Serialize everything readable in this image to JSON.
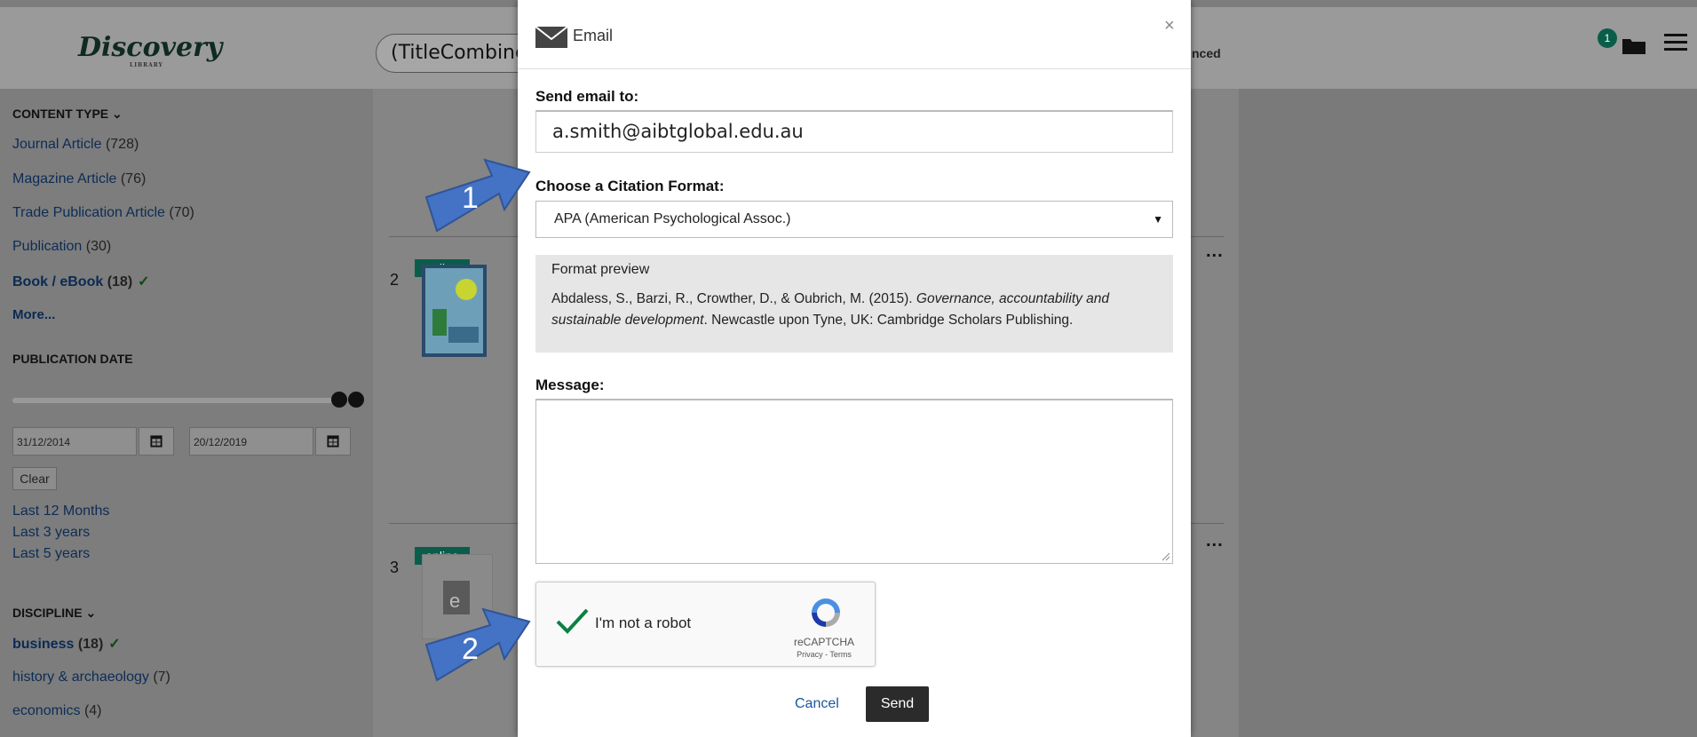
{
  "header": {
    "logo": "Discovery",
    "logo_sub": "LIBRARY",
    "search_value": "(TitleCombined",
    "advanced_label": "nced",
    "folder_badge": "1"
  },
  "sidebar": {
    "content_type_heading": "CONTENT TYPE",
    "content_types": [
      {
        "label": "Journal Article",
        "count": "(728)"
      },
      {
        "label": "Magazine Article",
        "count": "(76)"
      },
      {
        "label": "Trade Publication Article",
        "count": "(70)"
      },
      {
        "label": "Publication",
        "count": "(30)"
      },
      {
        "label": "Book / eBook",
        "count": "(18)",
        "selected": true
      }
    ],
    "more_label": "More...",
    "pub_date_heading": "PUBLICATION DATE",
    "date_from": "31/12/2014",
    "date_to": "20/12/2019",
    "clear_label": "Clear",
    "date_shortcuts": [
      "Last 12 Months",
      "Last 3 years",
      "Last 5 years"
    ],
    "discipline_heading": "DISCIPLINE",
    "disciplines": [
      {
        "label": "business",
        "count": "(18)",
        "selected": true
      },
      {
        "label": "history & archaeology",
        "count": "(7)"
      },
      {
        "label": "economics",
        "count": "(4)"
      }
    ]
  },
  "results": {
    "items": [
      {
        "number": "2",
        "tag": "online"
      },
      {
        "number": "3",
        "tag": "online"
      }
    ],
    "more_icon": "..."
  },
  "modal": {
    "title": "Email",
    "close": "×",
    "send_to_label": "Send email to:",
    "email_value": "a.smith@aibtglobal.edu.au",
    "citation_label": "Choose a Citation Format:",
    "citation_selected": "APA (American Psychological Assoc.)",
    "preview_title": "Format preview",
    "preview_authors": "Abdaless, S., Barzi, R., Crowther, D., & Oubrich, M. (2015). ",
    "preview_book_title": "Governance, accountability and sustainable development",
    "preview_rest": ". Newcastle upon Tyne, UK: Cambridge Scholars Publishing.",
    "message_label": "Message:",
    "captcha_label": "I'm not a robot",
    "captcha_brand": "reCAPTCHA",
    "captcha_links": "Privacy - Terms",
    "cancel_label": "Cancel",
    "send_label": "Send"
  },
  "annotations": {
    "callout_1": "1",
    "callout_2": "2"
  },
  "colors": {
    "accent_green": "#0b5d4b",
    "link_blue": "#1a56a0",
    "callout_blue": "#4472c4"
  }
}
